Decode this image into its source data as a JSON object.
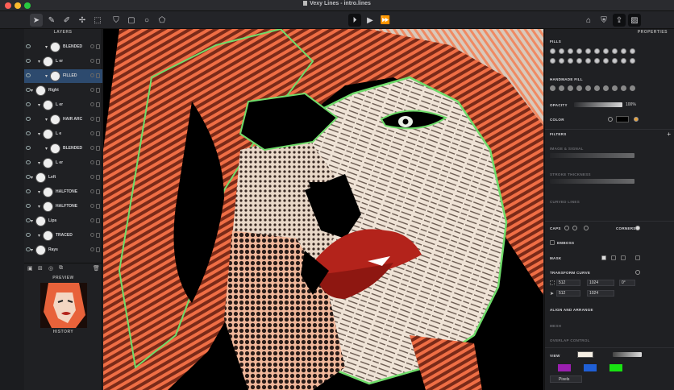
{
  "window": {
    "title": "Vexy Lines - intro.lines"
  },
  "toolbar": {
    "play_icons": [
      "step",
      "play",
      "fast-forward"
    ]
  },
  "layers_panel": {
    "title": "LAYERS",
    "items": [
      {
        "label": "BLENDED",
        "indent": 2
      },
      {
        "label": "L er",
        "indent": 1
      },
      {
        "label": "FILLED",
        "indent": 2,
        "selected": true
      },
      {
        "label": "Right",
        "indent": 0
      },
      {
        "label": "L er",
        "indent": 1
      },
      {
        "label": "HAIR ARC",
        "indent": 2
      },
      {
        "label": "L e",
        "indent": 1
      },
      {
        "label": "BLENDED",
        "indent": 2
      },
      {
        "label": "L er",
        "indent": 1
      },
      {
        "label": "Left",
        "indent": 0
      },
      {
        "label": "HALFTONE",
        "indent": 1
      },
      {
        "label": "HALFTONE",
        "indent": 1
      },
      {
        "label": "Lips",
        "indent": 0
      },
      {
        "label": "TRACED",
        "indent": 1
      },
      {
        "label": "Rays",
        "indent": 0
      }
    ]
  },
  "preview_panel": {
    "title": "PREVIEW"
  },
  "history_panel": {
    "title": "HISTORY"
  },
  "properties_panel": {
    "title": "PROPERTIES",
    "fills_label": "FILLS",
    "handmade_fill_label": "HANDMADE FILL",
    "opacity_label": "OPACITY",
    "opacity_value": "100%",
    "color_label": "COLOR",
    "filters_label": "FILTERS",
    "image_signal_label": "IMAGE & SIGNAL",
    "stroke_thickness_label": "STROKE THICKNESS",
    "curved_lines_label": "CURVED LINES",
    "caps_label": "CAPS",
    "corners_label": "CORNERS",
    "emboss_label": "EMBOSS",
    "mask_label": "MASK",
    "transform_curve_label": "TRANSFORM CURVE",
    "x_value": "512",
    "w_value": "1024",
    "angle_value": "0°",
    "y_value": "512",
    "h_value": "1024",
    "align_arrange_label": "ALIGN AND ARRANGE",
    "mesh_label": "MESH",
    "overlap_control_label": "OVERLAP CONTROL",
    "view_label": "VIEW",
    "units_value": "Pixels",
    "view_colors": [
      "#9b1fb0",
      "#1f5fd6",
      "#18e312"
    ]
  },
  "colors": {
    "selection": "#2d4a6e",
    "lip_red": "#b3231b",
    "hair_orange": "#e8623a",
    "outline_green": "#6fdc6a"
  }
}
